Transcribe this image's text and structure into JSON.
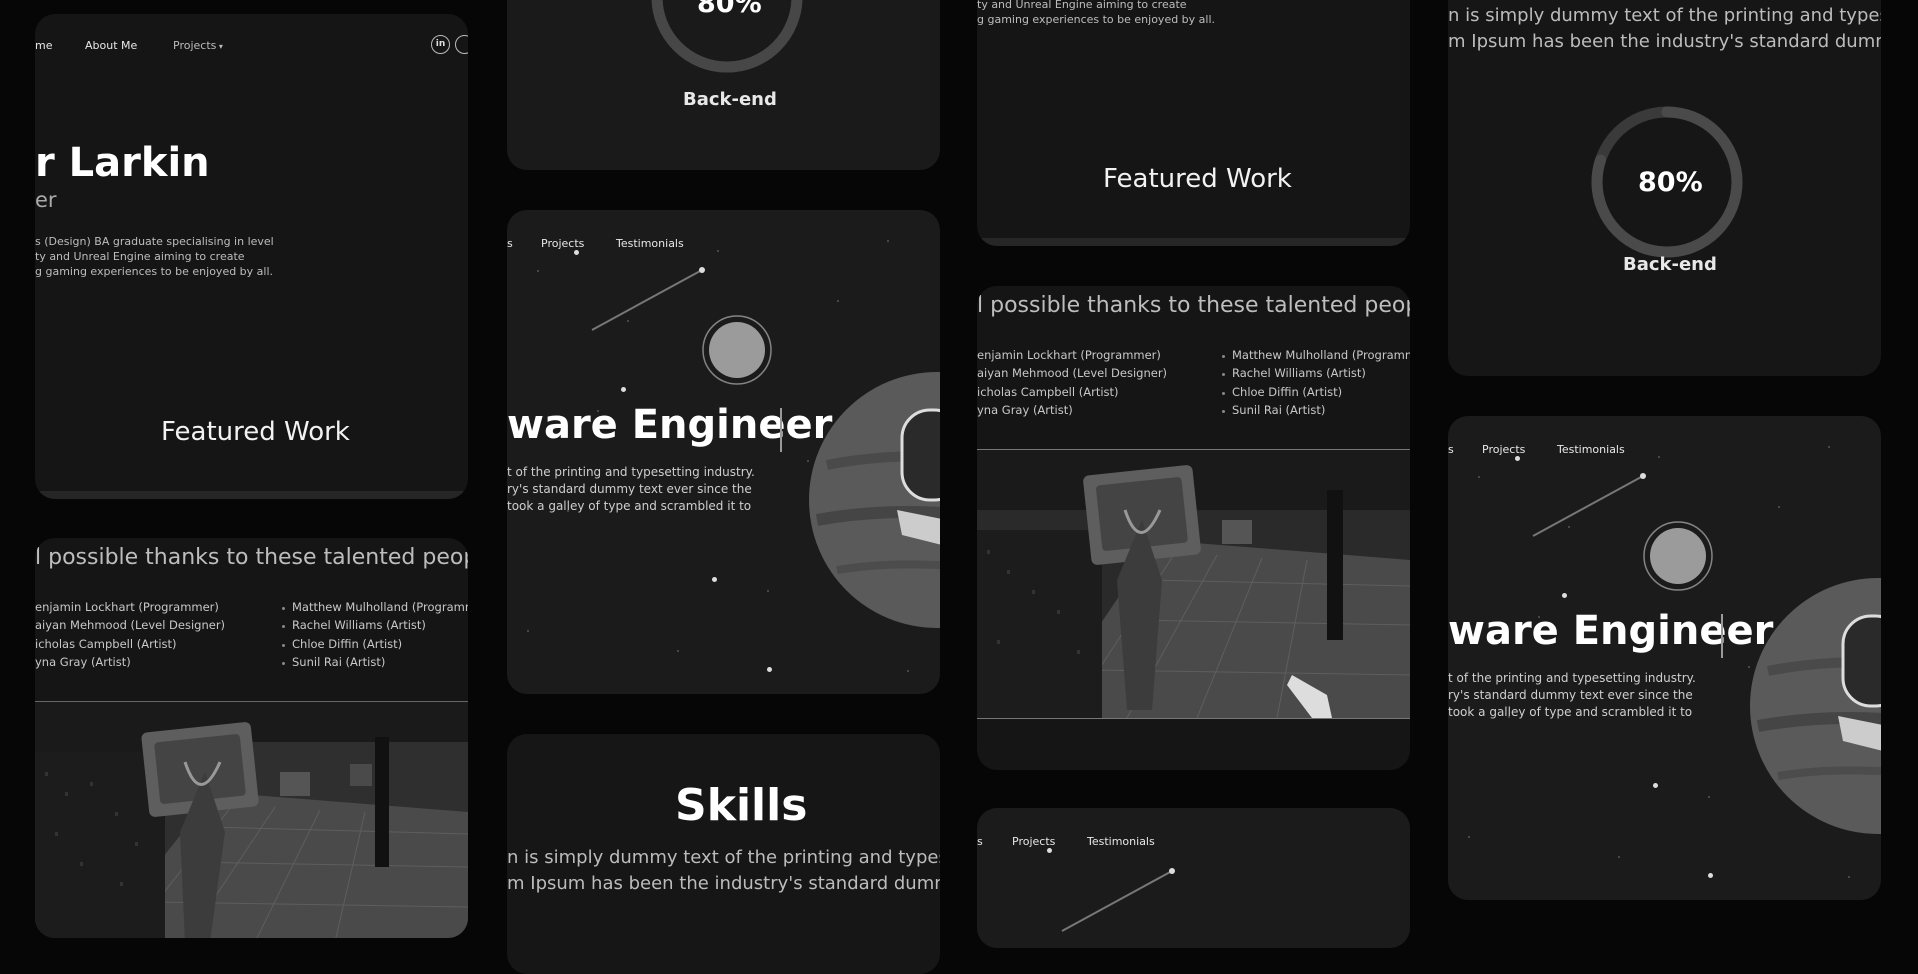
{
  "nav": {
    "home_fragment": "me",
    "about": "About Me",
    "projects": "Projects",
    "projects_fragment": "s",
    "testimonials": "Testimonials"
  },
  "social": {
    "linkedin_label": "in"
  },
  "profile": {
    "name_fragment": "r Larkin",
    "role_fragment": "er",
    "bio": [
      "s (Design) BA graduate specialising in level",
      "ty and Unreal Engine aiming to create",
      "g gaming experiences to be enjoyed by all."
    ],
    "bio_partial": [
      "ty and Unreal Engine aiming to create",
      "g gaming experiences to be enjoyed by all."
    ]
  },
  "featured": {
    "title": "Featured Work"
  },
  "thanks": {
    "heading": "l possible thanks to these talented people!",
    "col1": [
      "enjamin Lockhart (Programmer)",
      "aiyan Mehmood (Level Designer)",
      "icholas Campbell (Artist)",
      "yna Gray (Artist)"
    ],
    "col2": [
      "Matthew Mulholland (Programmer)",
      "Rachel Williams (Artist)",
      "Chloe Diffin (Artist)",
      "Sunil Rai (Artist)"
    ]
  },
  "skill": {
    "percent_full": "80%",
    "percent_partial": "80%",
    "label": "Back-end",
    "value": 0.8
  },
  "hero": {
    "title": "ware Engineer",
    "blurb": [
      "t of the printing and typesetting industry.",
      "ry's standard dummy text ever since the",
      "took a galley of type and scrambled it to"
    ]
  },
  "skills_section": {
    "title": "Skills",
    "lorem": [
      "n is simply dummy text of the printing and typesetting",
      "m Ipsum has been the industry's standard dummy text"
    ]
  },
  "colors": {
    "bg": "#060606",
    "card": "#161616",
    "ring_track": "#3a3a3a",
    "ring_fill": "#4a4a4a"
  }
}
